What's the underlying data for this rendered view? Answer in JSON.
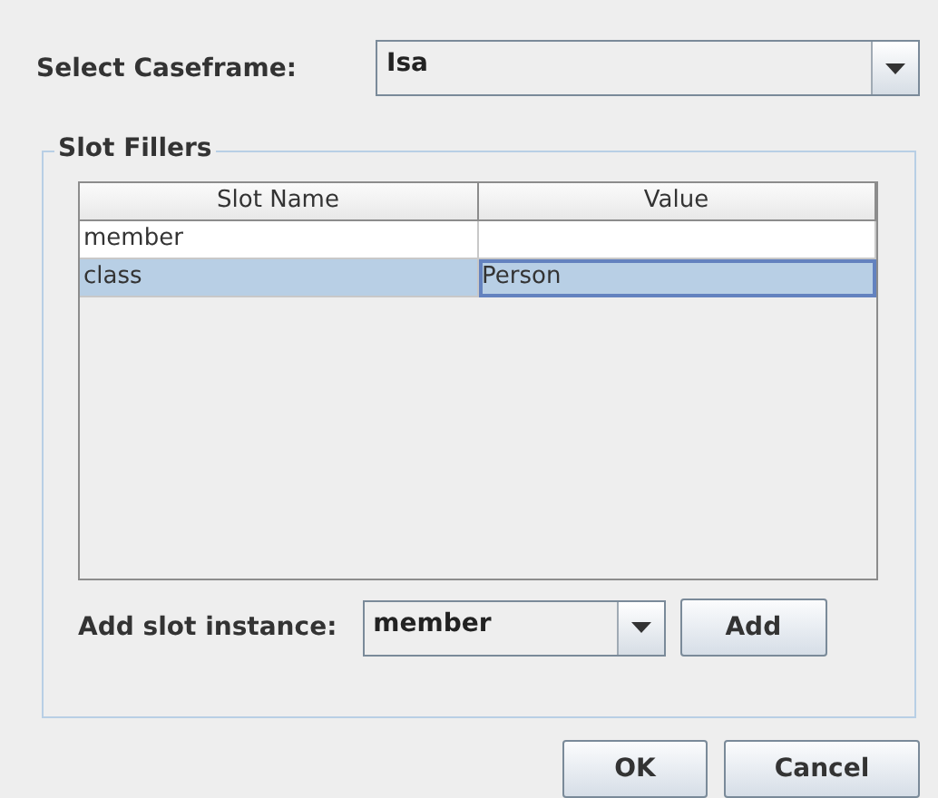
{
  "caseframe": {
    "label": "Select Caseframe:",
    "value": "Isa"
  },
  "slot_fillers": {
    "title": "Slot Fillers",
    "table": {
      "columns": [
        "Slot Name",
        "Value"
      ],
      "rows": [
        {
          "cells": [
            "member",
            ""
          ],
          "selected": false
        },
        {
          "cells": [
            "class",
            "Person"
          ],
          "selected": true
        }
      ]
    },
    "add_slot": {
      "label": "Add slot instance:",
      "value": "member",
      "button": "Add"
    }
  },
  "buttons": [
    "OK",
    "Cancel"
  ]
}
